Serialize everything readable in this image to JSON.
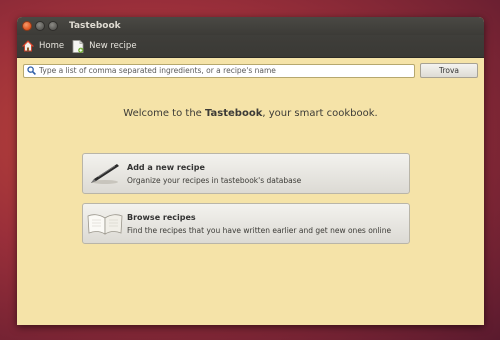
{
  "window": {
    "title": "Tastebook"
  },
  "toolbar": {
    "home_label": "Home",
    "new_recipe_label": "New recipe"
  },
  "search": {
    "placeholder": "Type a list of comma separated ingredients, or a recipe's name",
    "button_label": "Trova"
  },
  "welcome": {
    "prefix": "Welcome to the ",
    "brand": "Tastebook",
    "suffix": ", your smart cookbook."
  },
  "actions": [
    {
      "title": "Add a new recipe",
      "subtitle": "Organize your recipes in tastebook's database",
      "icon": "pen-icon"
    },
    {
      "title": "Browse recipes",
      "subtitle": "Find the recipes that you have written earlier and get new ones online",
      "icon": "open-book-icon"
    }
  ],
  "colors": {
    "window_bg": "#f5e3a8",
    "titlebar": "#3c3b37",
    "close_button": "#e0541f"
  }
}
